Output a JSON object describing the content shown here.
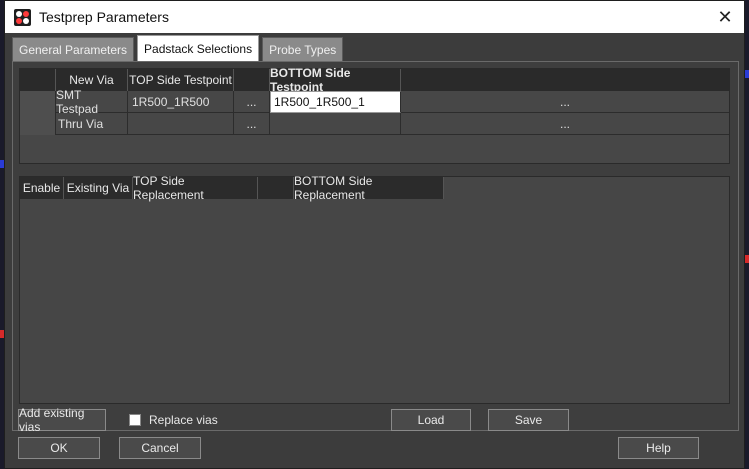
{
  "window": {
    "title": "Testprep Parameters",
    "close_glyph": "✕"
  },
  "tabs": [
    {
      "label": "General Parameters",
      "active": false
    },
    {
      "label": "Padstack Selections",
      "active": true
    },
    {
      "label": "Probe Types",
      "active": false
    }
  ],
  "via_table": {
    "headers": [
      "New Via",
      "TOP Side Testpoint",
      "",
      "BOTTOM Side Testpoint",
      ""
    ],
    "rows": [
      {
        "new_via": "SMT Testpad",
        "top": "1R500_1R500",
        "top_btn": "...",
        "bottom": "1R500_1R500_1",
        "bottom_btn": "..."
      },
      {
        "new_via": "Thru Via",
        "top": "",
        "top_btn": "...",
        "bottom": "",
        "bottom_btn": "..."
      }
    ]
  },
  "replace_table": {
    "headers": [
      "Enable",
      "Existing Via",
      "TOP Side Replacement",
      "",
      "BOTTOM Side Replacement"
    ]
  },
  "actions": {
    "add_existing": "Add existing vias",
    "replace_vias": "Replace vias",
    "load": "Load",
    "save": "Save",
    "ok": "OK",
    "cancel": "Cancel",
    "help": "Help"
  }
}
